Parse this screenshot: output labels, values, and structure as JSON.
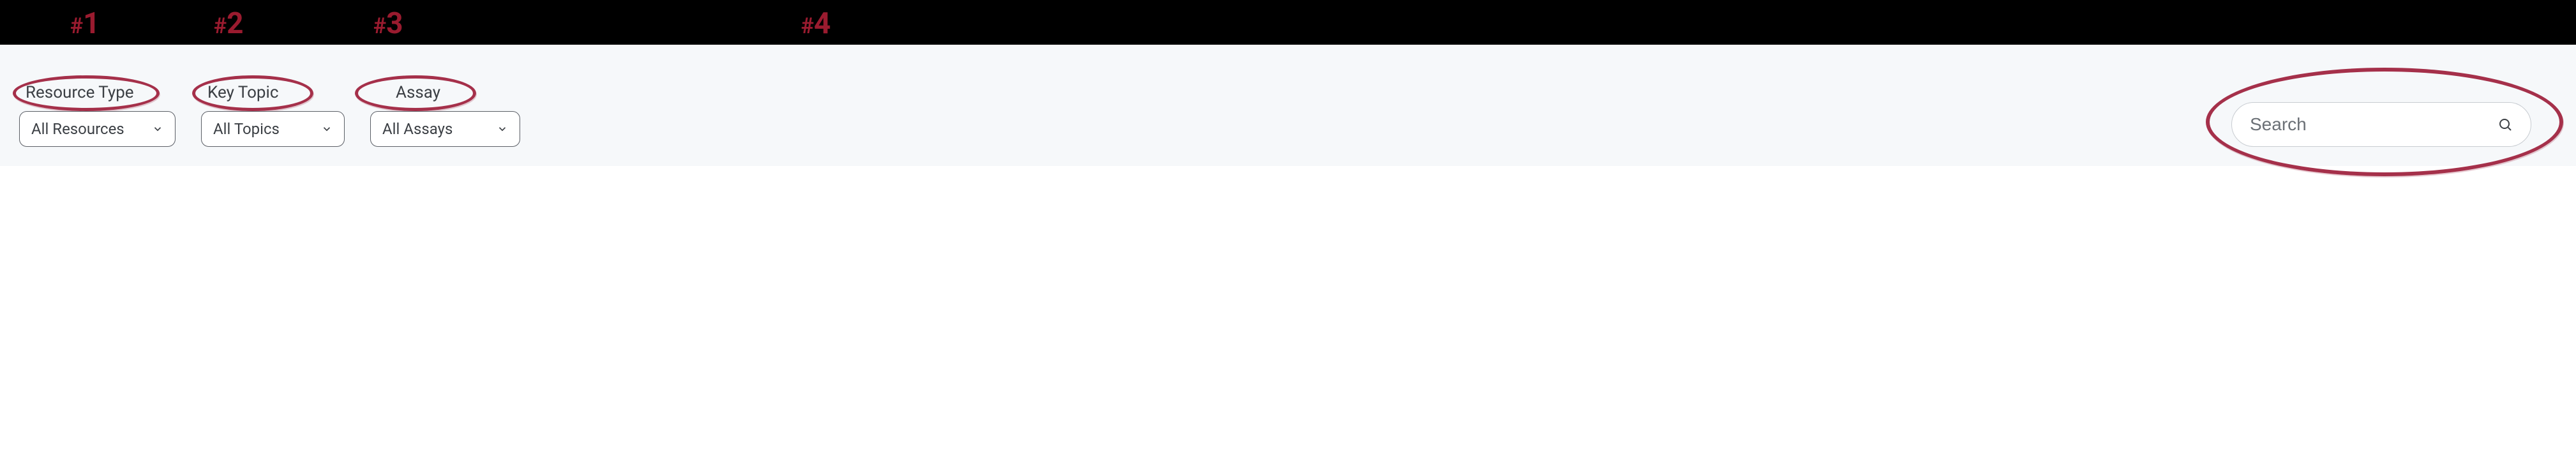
{
  "annotations": {
    "one": "#1",
    "two": "#2",
    "three": "#3",
    "four": "#4"
  },
  "filters": {
    "resource_type": {
      "label": "Resource Type",
      "selected": "All Resources"
    },
    "key_topic": {
      "label": "Key Topic",
      "selected": "All Topics"
    },
    "assay": {
      "label": "Assay",
      "selected": "All Assays"
    }
  },
  "search": {
    "placeholder": "Search",
    "value": ""
  },
  "colors": {
    "annotation": "#9a1b2f",
    "ellipse": "#a5304a",
    "border": "#5b5f66",
    "bg_bar": "#f6f8fa"
  }
}
